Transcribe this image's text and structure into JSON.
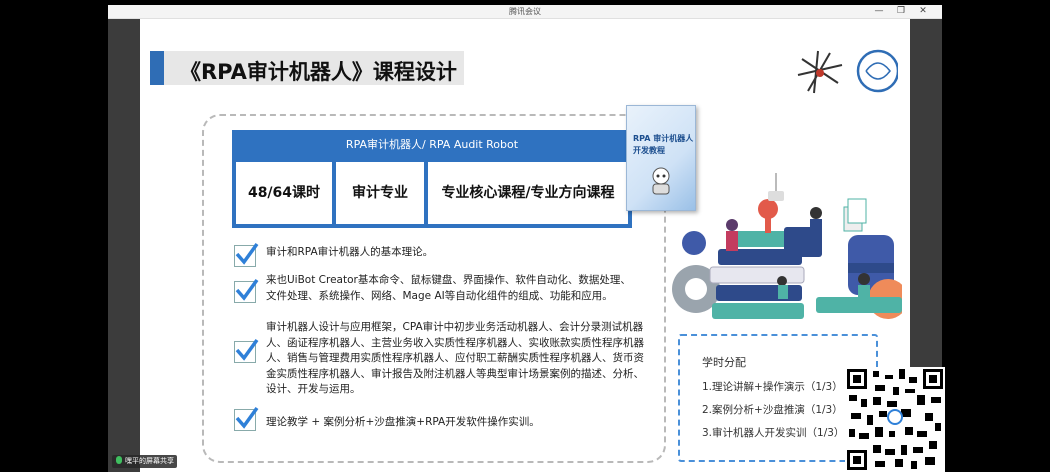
{
  "window": {
    "title": "腾讯会议"
  },
  "slide": {
    "title": "《RPA审计机器人》课程设计",
    "course_header": "RPA审计机器人/ RPA Audit Robot",
    "course_cells": [
      "48/64课时",
      "审计专业",
      "专业核心课程/专业方向课程"
    ],
    "book": {
      "title_line1": "RPA 审计机器人",
      "title_line2": "开发教程"
    },
    "points": [
      "审计和RPA审计机器人的基本理论。",
      "来也UiBot Creator基本命令、鼠标键盘、界面操作、软件自动化、数据处理、文件处理、系统操作、网络、Mage AI等自动化组件的组成、功能和应用。",
      "审计机器人设计与应用框架，CPA审计中初步业务活动机器人、会计分录测试机器人、函证程序机器人、主营业务收入实质性程序机器人、实收账款实质性程序机器人、销售与管理费用实质性程序机器人、应付职工薪酬实质性程序机器人、货币资金实质性程序机器人、审计报告及附注机器人等典型审计场景案例的描述、分析、设计、开发与运用。",
      "理论教学 + 案例分析+沙盘推演+RPA开发软件操作实训。"
    ],
    "allocation": {
      "title": "学时分配",
      "items": [
        "1.理论讲解+操作演示（1/3）",
        "2.案例分析+沙盘推演（1/3）",
        "3.审计机器人开发实训（1/3）"
      ]
    }
  },
  "overlay": {
    "share_label": "嘿平的屏幕共享"
  },
  "colors": {
    "accent": "#2f6db5",
    "card": "#2f72c0",
    "check": "#2f80d8"
  }
}
